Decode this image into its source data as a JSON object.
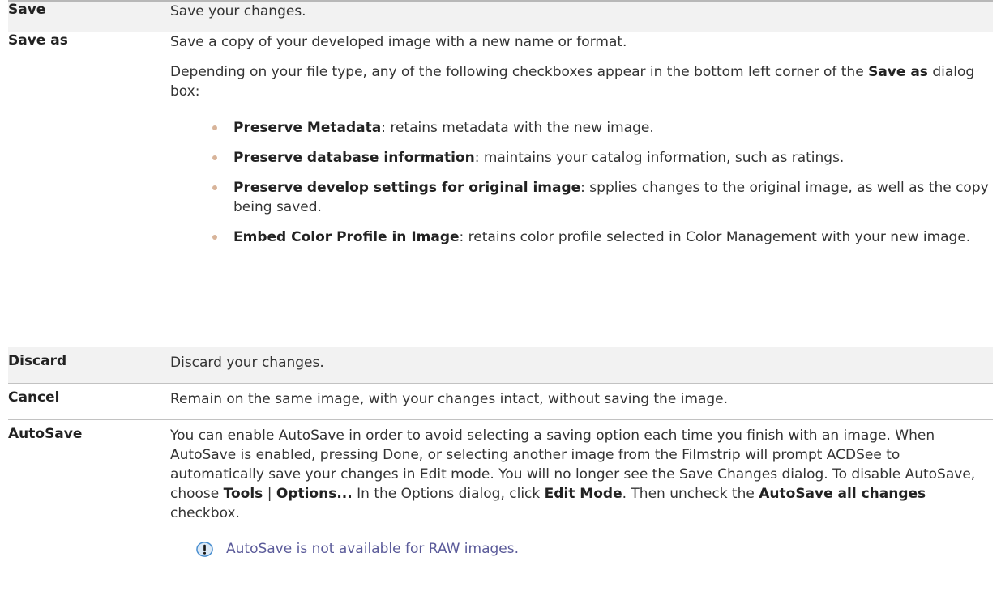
{
  "rows": [
    {
      "term": "Save",
      "desc": "Save your changes."
    },
    {
      "term": "Save as",
      "desc": "Save a copy of your developed image with a new name or format.",
      "intro_before": "Depending on your file type, any of the following checkboxes appear in the bottom left corner of the ",
      "intro_bold": "Save as",
      "intro_after": " dialog box:",
      "bullets": [
        {
          "bold": "Preserve Metadata",
          "text": ": retains metadata with the new image."
        },
        {
          "bold": "Preserve database information",
          "text": ": maintains your catalog information, such as ratings."
        },
        {
          "bold": "Preserve develop settings for original image",
          "text": ": spplies changes to the original image, as well as the copy being saved."
        },
        {
          "bold": "Embed Color Profile in Image",
          "text": ": retains color profile selected in Color Management with your new image."
        }
      ]
    },
    {
      "term": "Discard",
      "desc": "Discard your changes."
    },
    {
      "term": "Cancel",
      "desc": "Remain on the same image, with your changes intact, without saving the image."
    },
    {
      "term": "AutoSave",
      "parts": [
        "You can enable AutoSave in order to avoid selecting a saving option each time you finish with an image. When AutoSave is enabled, pressing Done, or selecting another image from the Filmstrip will prompt ACDSee to automatically save your changes in Edit mode. You will no longer see the Save Changes dialog. To disable AutoSave, choose ",
        "Tools",
        " | ",
        "Options...",
        " In the Options dialog, click ",
        "Edit Mode",
        ". Then uncheck the ",
        "AutoSave all changes",
        " checkbox."
      ],
      "note": "AutoSave is not available for RAW images."
    }
  ],
  "colors": {
    "shade": "#f2f2f2",
    "bullet": "#d8b49a",
    "note_text": "#5a5a99",
    "note_icon": "#4a8fd0"
  },
  "icons": {
    "bullet": "bullet-dot",
    "note": "note-info-icon"
  }
}
